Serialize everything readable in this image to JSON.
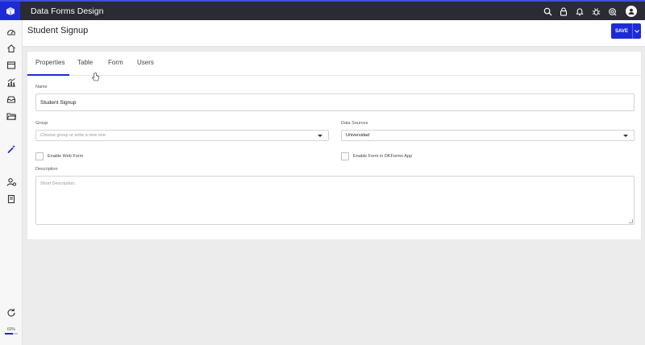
{
  "app": {
    "title": "Data Forms Design"
  },
  "header": {
    "page_title": "Student Signup",
    "save_label": "SAVE"
  },
  "tabs": [
    {
      "label": "Properties",
      "active": true
    },
    {
      "label": "Table",
      "active": false
    },
    {
      "label": "Form",
      "active": false
    },
    {
      "label": "Users",
      "active": false
    }
  ],
  "form": {
    "name_label": "Name",
    "name_value": "Student Signup",
    "group_label": "Group",
    "group_placeholder": "Choose group or write a new one",
    "data_sources_label": "Data Sources",
    "data_sources_value": "Universidad",
    "enable_web_form_label": "Enable Web Form",
    "enable_app_label": "Enable Form in DKForms App",
    "description_label": "Description",
    "description_placeholder": "Short Description."
  },
  "sidebar": {
    "icons": [
      "dashboard-icon",
      "home-icon",
      "window-icon",
      "analytics-icon",
      "inbox-icon",
      "folder-icon",
      "magic-wand-icon",
      "user-settings-icon",
      "book-icon",
      "refresh-icon"
    ],
    "zoom_label": "60%",
    "zoom_fraction": 0.6
  },
  "topbar_icons": [
    "search-icon",
    "lock-icon",
    "bell-icon",
    "bug-icon",
    "support-icon",
    "user-avatar-icon"
  ],
  "colors": {
    "accent": "#1d2bd6",
    "topbar": "#2b2b33"
  }
}
